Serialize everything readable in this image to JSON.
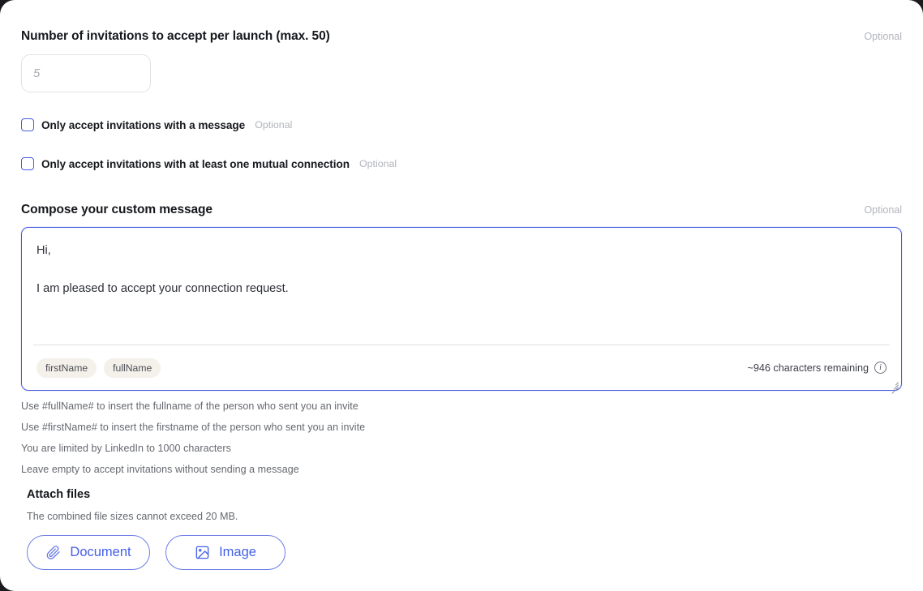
{
  "form": {
    "invitations": {
      "label": "Number of invitations to accept per launch (max. 50)",
      "optional": "Optional",
      "value": "",
      "placeholder": "5"
    },
    "checkboxes": [
      {
        "label": "Only accept invitations with a message",
        "optional": "Optional",
        "checked": false
      },
      {
        "label": "Only accept invitations with at least one mutual connection",
        "optional": "Optional",
        "checked": false
      }
    ],
    "compose": {
      "label": "Compose your custom message",
      "optional": "Optional",
      "line1": "Hi,",
      "line2": "I am pleased to accept your connection request.",
      "chips": [
        "firstName",
        "fullName"
      ],
      "counter": "~946 characters remaining",
      "info_icon": "info-circle-icon"
    },
    "hints": [
      "Use #fullName# to insert the fullname of the person who sent you an invite",
      "Use #firstName# to insert the firstname of the person who sent you an invite",
      "You are limited by LinkedIn to 1000 characters",
      "Leave empty to accept invitations without sending a message"
    ],
    "attach": {
      "title": "Attach files",
      "note": "The combined file sizes cannot exceed 20 MB.",
      "document_label": "Document",
      "document_icon": "paperclip-icon",
      "image_label": "Image",
      "image_icon": "image-icon"
    }
  },
  "colors": {
    "accent_blue": "#4460e8",
    "checkbox_blue": "#4a5ddb",
    "chip_bg": "#f4f0ea",
    "muted_text": "#65686f",
    "optional_text": "#b2b4bb"
  }
}
